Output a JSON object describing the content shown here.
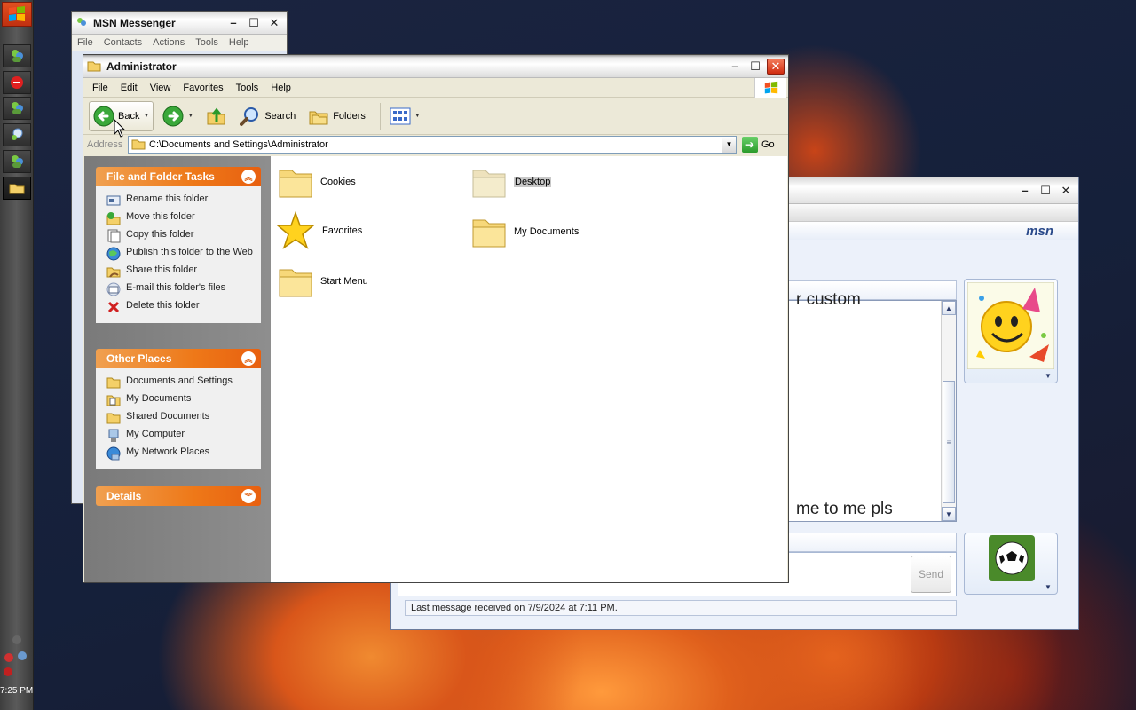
{
  "taskbar": {
    "clock": "7:25 PM",
    "buttons": [
      "messenger-icon",
      "stop-icon",
      "messenger-icon",
      "chat-icon",
      "messenger-icon",
      "folder-icon"
    ]
  },
  "msn_main": {
    "title": "MSN Messenger",
    "menu": [
      "File",
      "Contacts",
      "Actions",
      "Tools",
      "Help"
    ]
  },
  "conversation": {
    "logo": "msn",
    "history_line_top": "r custom",
    "history_line_bottom": "me to me pls",
    "send_label": "Send",
    "status": "Last message received on 7/9/2024 at 7:11 PM."
  },
  "explorer": {
    "title": "Administrator",
    "menu": [
      "File",
      "Edit",
      "View",
      "Favorites",
      "Tools",
      "Help"
    ],
    "toolbar": {
      "back": "Back",
      "search": "Search",
      "folders": "Folders"
    },
    "address": {
      "label": "Address",
      "value": "C:\\Documents and Settings\\Administrator",
      "go": "Go"
    },
    "file_tasks": {
      "title": "File and Folder Tasks",
      "items": [
        "Rename this folder",
        "Move this folder",
        "Copy this folder",
        "Publish this folder to the Web",
        "Share this folder",
        "E-mail this folder's files",
        "Delete this folder"
      ]
    },
    "other_places": {
      "title": "Other Places",
      "items": [
        "Documents and Settings",
        "My Documents",
        "Shared Documents",
        "My Computer",
        "My Network Places"
      ]
    },
    "details": {
      "title": "Details"
    },
    "files": [
      "Cookies",
      "Desktop",
      "Favorites",
      "My Documents",
      "Start Menu"
    ]
  },
  "colors": {
    "task_header": "#ee7818",
    "title_active": "#ffffff",
    "close_button": "#d02c10"
  }
}
